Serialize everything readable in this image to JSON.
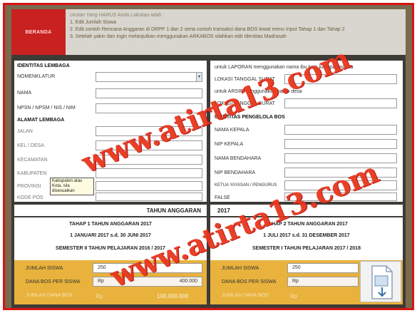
{
  "topbar": {
    "beranda_label": "BERANDA",
    "instr_title": "Urutan Yang HARUS Anda Lakukan ialah :",
    "steps": [
      "1. Edit Jumlah Siswa",
      "2. Edit contoh Rencana Anggaran di DRPP 1 dan 2 serta contoh transaksi dana BOS lewat menu Input Tahap 1 dan Tahap 2",
      "3. Setelah yakin dan ingin melanjutkan menggunakan ARKABOS silahkan edit Identitas Madrasah"
    ]
  },
  "left": {
    "identitas_header": "IDENTITAS LEMBAGA",
    "nomenklatur": "NOMENKLATUR",
    "nama": "NAMA",
    "npsn": "NPSN / NPSM / NIS / NIM",
    "alamat_header": "ALAMAT LEMBAGA",
    "jalan": "JALAN",
    "kel": "KEL / DESA",
    "kecamatan": "KECAMATAN",
    "kabupaten": "KABUPATEN",
    "provinsi": "PROVINSI",
    "kodepos": "KODE POS",
    "tooltip": "Kabupaten atau Kota, sila disesuaikan"
  },
  "right": {
    "laporan_note": "untuk LAPORAN menggunakan nama ibu kota kabupaten/kota",
    "lokasi1": "LOKASI TANGGAL SURAT",
    "arsip_note": "untuk ARSIP menggunakan nama desa",
    "lokasi2": "LOKASI TANGGAL SURAT",
    "pengelola_header": "IDENTITAS PENGELOLA BOS",
    "nama_kepala": "NAMA KEPALA",
    "nip_kepala": "NIP KEPALA",
    "nama_bendahara": "NAMA BENDAHARA",
    "nip_bendahara": "NIP BENDAHARA",
    "ketua": "KETUA YAYASAN / PENGURUS",
    "false_label": "FALSE"
  },
  "tahun": {
    "label": "TAHUN ANGGARAN",
    "value": "2017"
  },
  "tahap1": {
    "title": "TAHAP 1 TAHUN ANGGARAN 2017",
    "period": "1 JANUARI 2017 s.d. 30 JUNI 2017",
    "semester": "SEMESTER II TAHUN PELAJARAN 2016 / 2017",
    "jumlah_siswa_label": "JUMLAH SISWA",
    "jumlah_siswa": "250",
    "dana_label": "DANA BOS PER SISWA",
    "rp": "Rp",
    "dana_value": "400.000",
    "jumlah_dana_label": "JUMLAH DANA BOS",
    "jumlah_dana_value": "100.000.000"
  },
  "tahap2": {
    "title": "TAHAP 2 TAHUN ANGGARAN 2017",
    "period": "1 JULI 2017 s.d. 31 DESEMBER 2017",
    "semester": "SEMESTER I TAHUN PELAJARAN 2017 / 2018",
    "jumlah_siswa_label": "JUMLAH SISWA",
    "jumlah_siswa": "250",
    "dana_label": "DANA BOS PER SISWA",
    "rp": "Rp",
    "jumlah_dana_label": "JUMLAH DANA BOS",
    "rp2": "Rp"
  },
  "watermark": {
    "text1": "www.atirta13.com",
    "text2": "www.atirta13.com"
  },
  "colors": {
    "frame": "#d81414",
    "beranda": "#c92020",
    "gold": "#e8b23c",
    "watermark": "#e8361c"
  }
}
